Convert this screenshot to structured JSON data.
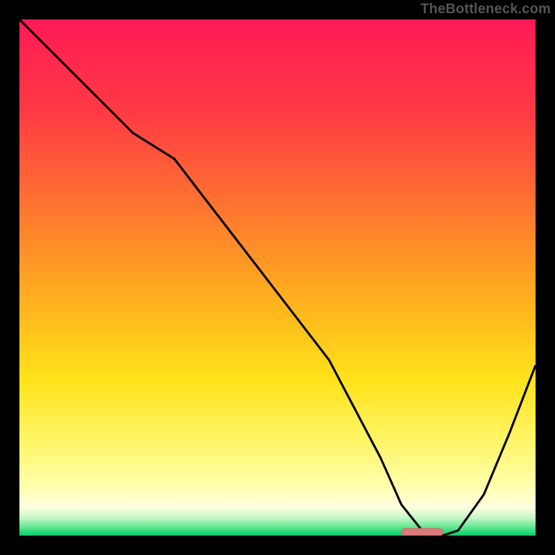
{
  "watermark": "TheBottleneck.com",
  "colors": {
    "bg": "#000000",
    "watermark": "#555555",
    "curve_stroke": "#000000",
    "marker_fill": "#db7a7a",
    "marker_stroke": "#c76a6a"
  },
  "chart_data": {
    "type": "line",
    "title": "",
    "xlabel": "",
    "ylabel": "",
    "xlim": [
      0,
      100
    ],
    "ylim": [
      0,
      100
    ],
    "gradient_stops": [
      {
        "offset": 0.0,
        "color": "#ff1a55"
      },
      {
        "offset": 0.18,
        "color": "#ff3a44"
      },
      {
        "offset": 0.38,
        "color": "#ff7a2e"
      },
      {
        "offset": 0.55,
        "color": "#ffb21e"
      },
      {
        "offset": 0.7,
        "color": "#ffe31a"
      },
      {
        "offset": 0.82,
        "color": "#fff56a"
      },
      {
        "offset": 0.9,
        "color": "#ffffa8"
      },
      {
        "offset": 0.945,
        "color": "#ffffe0"
      },
      {
        "offset": 0.965,
        "color": "#c8f7c8"
      },
      {
        "offset": 0.985,
        "color": "#5ae68c"
      },
      {
        "offset": 1.0,
        "color": "#00cf6a"
      }
    ],
    "curve": {
      "x": [
        0,
        10,
        22,
        30,
        40,
        50,
        60,
        70,
        74,
        78,
        82,
        85,
        90,
        95,
        100
      ],
      "y": [
        100,
        90,
        78,
        73,
        60,
        47,
        34,
        15,
        6,
        1,
        0,
        1,
        8,
        20,
        33
      ]
    },
    "marker": {
      "x_start": 74,
      "x_end": 82,
      "y": 0.7
    }
  }
}
